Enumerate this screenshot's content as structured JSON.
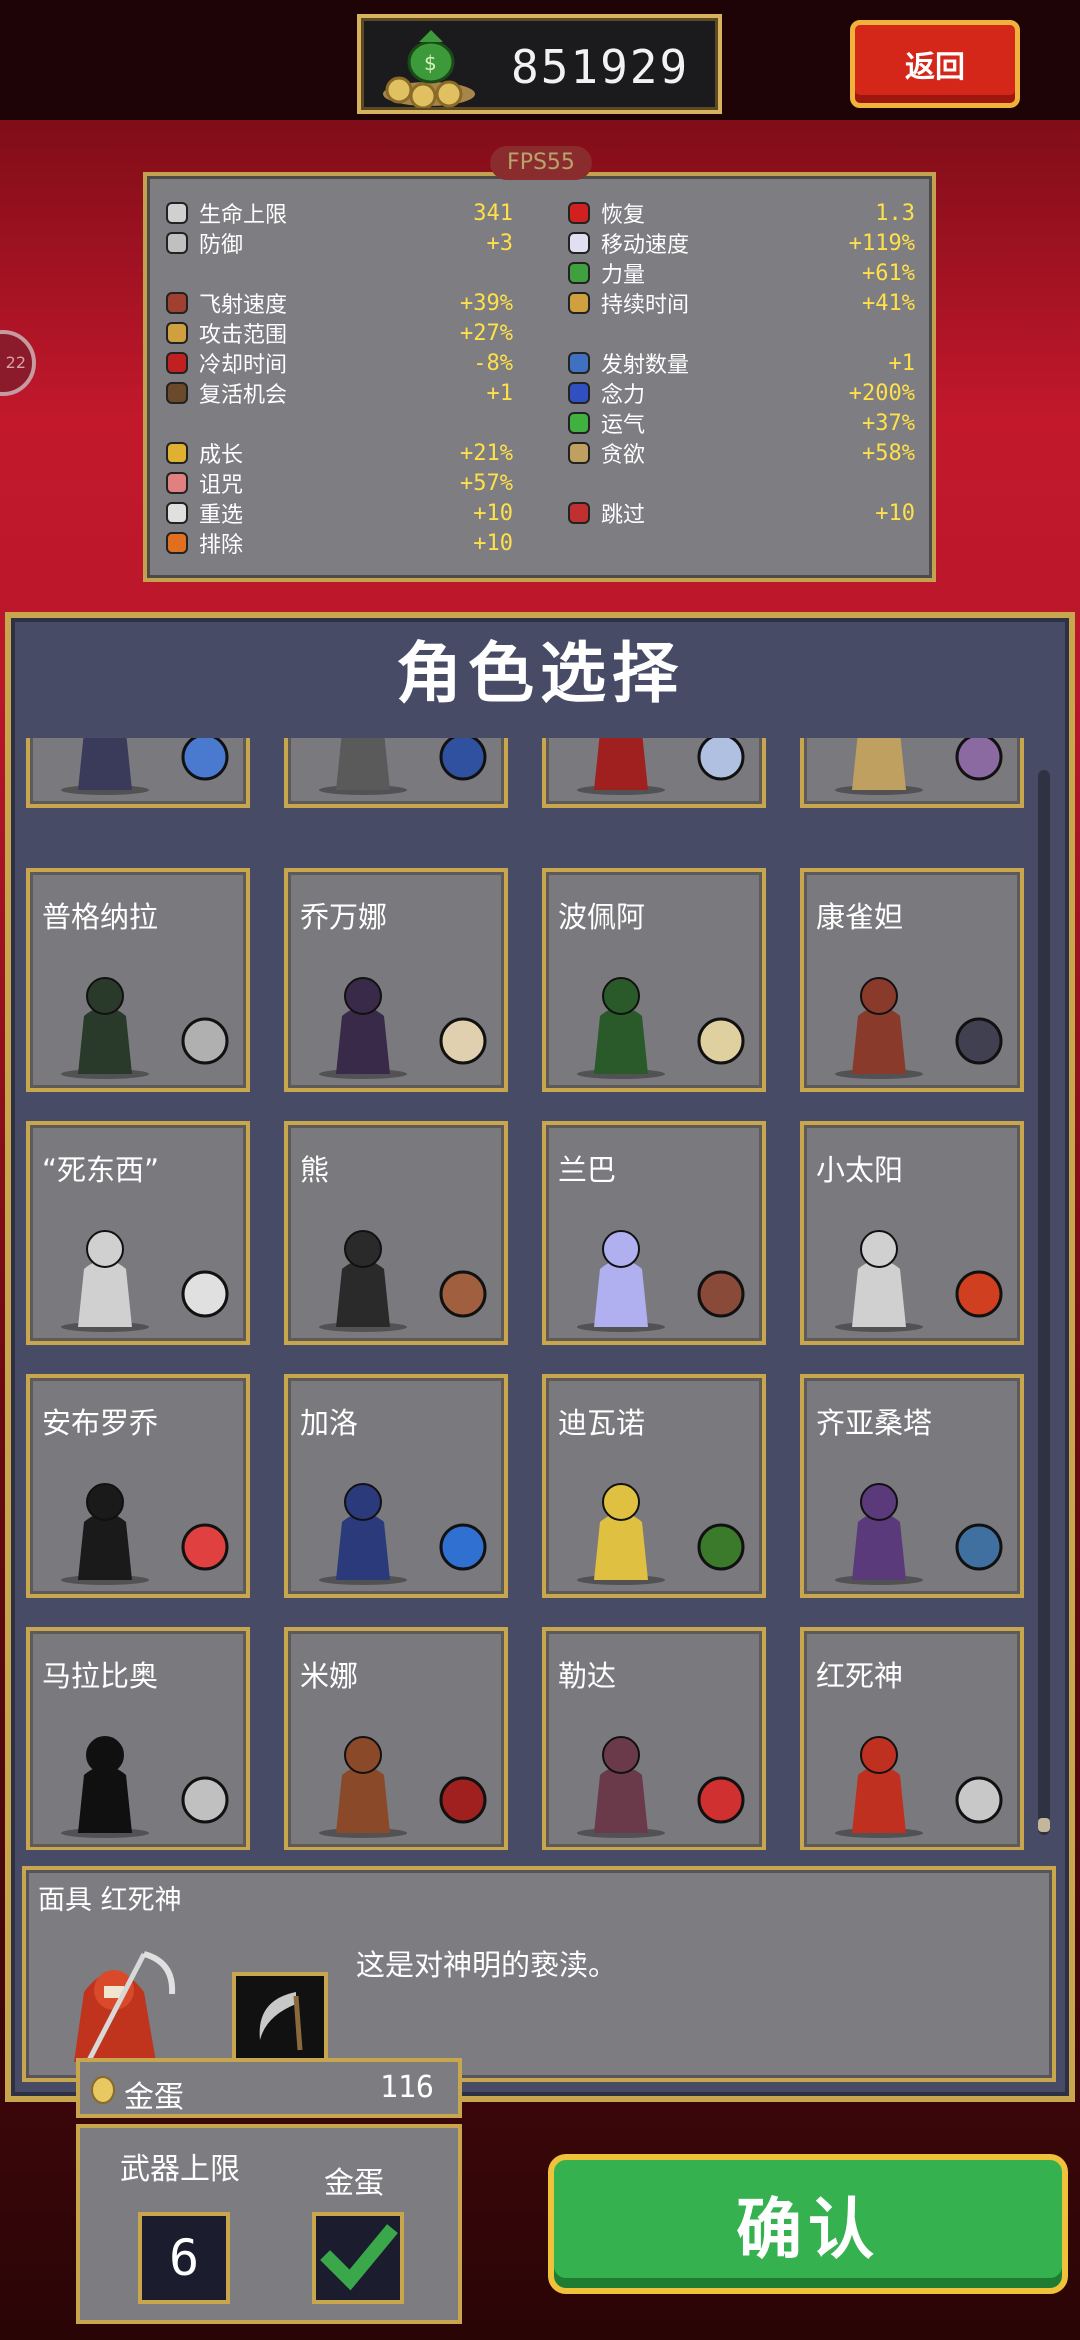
{
  "header": {
    "coins": "851929",
    "back_label": "返回",
    "fps": "FPS55",
    "side_bubble": "22"
  },
  "stats": {
    "left": [
      {
        "icon": "heart-outline-icon",
        "name": "生命上限",
        "value": "341"
      },
      {
        "icon": "armor-icon",
        "name": "防御",
        "value": "+3"
      },
      {
        "icon": "bracer-icon",
        "name": "飞射速度",
        "value": "+39%"
      },
      {
        "icon": "candelabra-icon",
        "name": "攻击范围",
        "value": "+27%"
      },
      {
        "icon": "spellbinder-icon",
        "name": "冷却时间",
        "value": "-8%"
      },
      {
        "icon": "tome-icon",
        "name": "复活机会",
        "value": "+1"
      },
      {
        "icon": "crown-icon",
        "name": "成长",
        "value": "+21%"
      },
      {
        "icon": "skull-icon",
        "name": "诅咒",
        "value": "+57%"
      },
      {
        "icon": "dice-icon",
        "name": "重选",
        "value": "+10"
      },
      {
        "icon": "banish-icon",
        "name": "排除",
        "value": "+10"
      }
    ],
    "right": [
      {
        "icon": "red-heart-icon",
        "name": "恢复",
        "value": "1.3"
      },
      {
        "icon": "wing-icon",
        "name": "移动速度",
        "value": "+119%"
      },
      {
        "icon": "spinach-icon",
        "name": "力量",
        "value": "+61%"
      },
      {
        "icon": "hourglass-icon",
        "name": "持续时间",
        "value": "+41%"
      },
      {
        "icon": "duplicator-icon",
        "name": "发射数量",
        "value": "+1"
      },
      {
        "icon": "attractorb-icon",
        "name": "念力",
        "value": "+200%"
      },
      {
        "icon": "clover-icon",
        "name": "运气",
        "value": "+37%"
      },
      {
        "icon": "greed-icon",
        "name": "贪欲",
        "value": "+58%"
      },
      {
        "icon": "skip-icon",
        "name": "跳过",
        "value": "+10"
      }
    ]
  },
  "character_select": {
    "title": "角色选择",
    "rows": [
      [
        {
          "name": ""
        },
        {
          "name": ""
        },
        {
          "name": ""
        },
        {
          "name": ""
        }
      ],
      [
        {
          "name": "普格纳拉"
        },
        {
          "name": "乔万娜"
        },
        {
          "name": "波佩阿"
        },
        {
          "name": "康雀妲"
        }
      ],
      [
        {
          "name": "“死东西”"
        },
        {
          "name": "熊"
        },
        {
          "name": "兰巴"
        },
        {
          "name": "小太阳"
        }
      ],
      [
        {
          "name": "安布罗乔"
        },
        {
          "name": "加洛"
        },
        {
          "name": "迪瓦诺"
        },
        {
          "name": "齐亚桑塔"
        }
      ],
      [
        {
          "name": "马拉比奥"
        },
        {
          "name": "米娜"
        },
        {
          "name": "勒达"
        },
        {
          "name": "红死神"
        }
      ]
    ]
  },
  "detail": {
    "title": "面具  红死神",
    "description": "这是对神明的亵渎。"
  },
  "gold_egg": {
    "label": "金蛋",
    "value": "116"
  },
  "options": {
    "weapon_limit_label": "武器上限",
    "weapon_limit_value": "6",
    "gold_egg_label": "金蛋",
    "gold_egg_checked": "true"
  },
  "confirm_label": "确认",
  "colors": {
    "accent_gold": "#c7a64e",
    "stat_value": "#ffe04a",
    "confirm_green": "#35b24f",
    "back_red": "#d5261a"
  }
}
